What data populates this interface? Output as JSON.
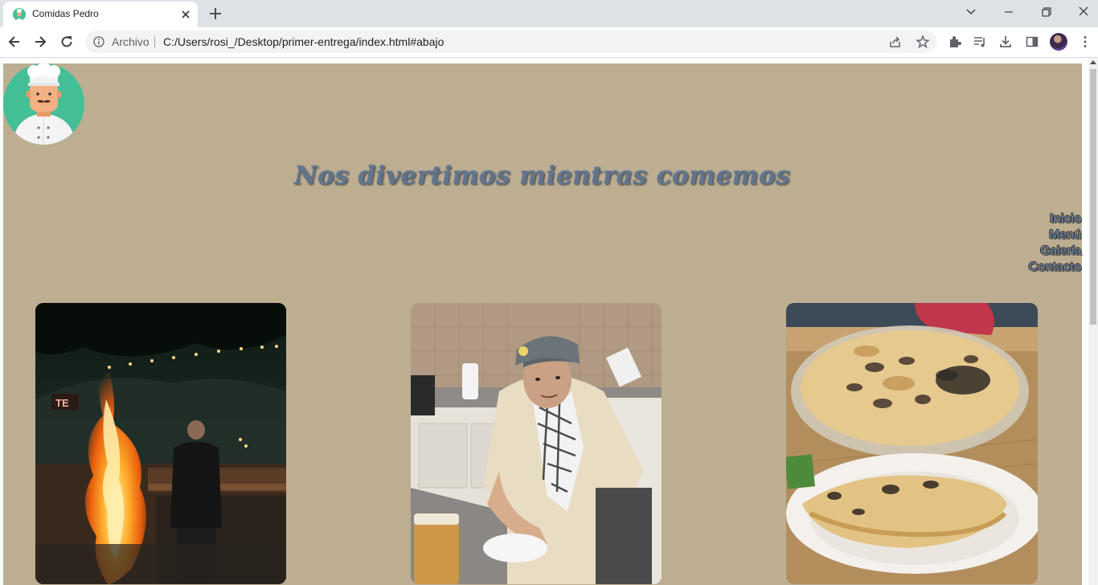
{
  "browser": {
    "tab_title": "Comidas Pedro",
    "omnibox_scheme": "Archivo",
    "omnibox_url": "C:/Users/rosi_/Desktop/primer-entrega/index.html#abajo"
  },
  "page": {
    "headline": "Nos divertimos mientras comemos",
    "nav": [
      "Inicio",
      "Menú",
      "Galería",
      "Contacto"
    ],
    "gallery": [
      {
        "subject": "campfire-photo"
      },
      {
        "subject": "cook-portrait-photo"
      },
      {
        "subject": "lasagna-photo"
      }
    ],
    "colors": {
      "page_bg": "#bdae92",
      "logo_bg": "#45bf96",
      "headline": "#63748a",
      "nav_text": "#6b7b8f"
    }
  }
}
